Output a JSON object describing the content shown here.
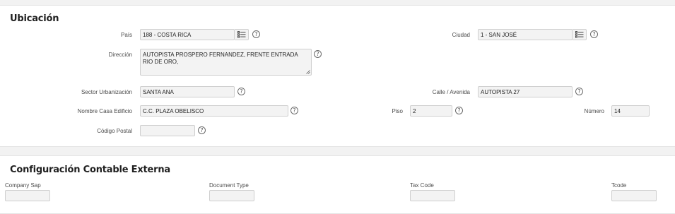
{
  "ubicacion": {
    "title": "Ubicación",
    "pais": {
      "label": "País",
      "value": "188 - COSTA RICA"
    },
    "ciudad": {
      "label": "Ciudad",
      "value": "1 - SAN JOSÉ"
    },
    "direccion": {
      "label": "Dirección",
      "value": "AUTOPISTA PROSPERO FERNANDEZ, FRENTE ENTRADA RIO DE ORO,"
    },
    "sector": {
      "label": "Sector Urbanización",
      "value": "SANTA ANA"
    },
    "calle": {
      "label": "Calle / Avenida",
      "value": "AUTOPISTA 27"
    },
    "nombre_casa": {
      "label": "Nombre Casa Edificio",
      "value": "C.C. PLAZA OBELISCO"
    },
    "piso": {
      "label": "Piso",
      "value": "2"
    },
    "numero": {
      "label": "Número",
      "value": "14"
    },
    "codigo_postal": {
      "label": "Código Postal",
      "value": ""
    },
    "help_glyph": "?"
  },
  "configuracion": {
    "title": "Configuración Contable Externa",
    "company_sap": {
      "label": "Company Sap",
      "value": ""
    },
    "document_type": {
      "label": "Document Type",
      "value": ""
    },
    "tax_code": {
      "label": "Tax Code",
      "value": ""
    },
    "tcode": {
      "label": "Tcode",
      "value": ""
    }
  },
  "icons": {
    "lov": "list-icon",
    "help": "help-icon"
  }
}
